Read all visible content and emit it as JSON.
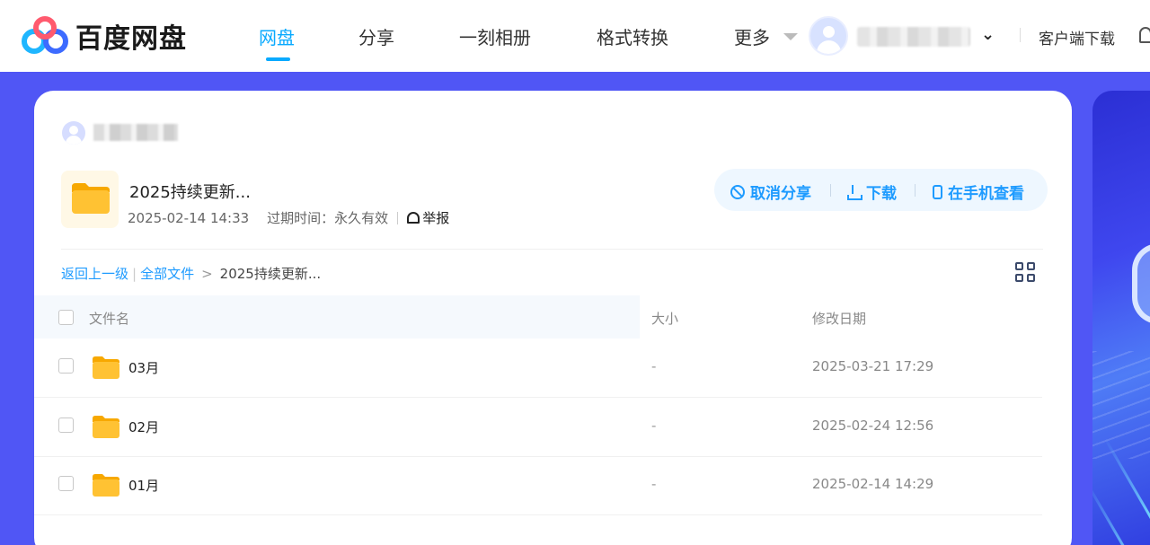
{
  "brand": {
    "name": "百度网盘"
  },
  "nav": {
    "items": [
      {
        "label": "网盘",
        "active": true
      },
      {
        "label": "分享",
        "active": false
      },
      {
        "label": "一刻相册",
        "active": false
      },
      {
        "label": "格式转换",
        "active": false
      },
      {
        "label": "更多",
        "active": false
      }
    ],
    "client_download": "客户端下载"
  },
  "share": {
    "title": "2025持续更新...",
    "date": "2025-02-14 14:33",
    "expire_label": "过期时间：永久有效",
    "report": "举报"
  },
  "actions": {
    "cancel_share": "取消分享",
    "download": "下载",
    "view_on_phone": "在手机查看"
  },
  "breadcrumb": {
    "back": "返回上一级",
    "all_files": "全部文件",
    "current": "2025持续更新..."
  },
  "table": {
    "columns": {
      "name": "文件名",
      "size": "大小",
      "modified": "修改日期"
    },
    "rows": [
      {
        "name": "03月",
        "size": "-",
        "modified": "2025-03-21 17:29"
      },
      {
        "name": "02月",
        "size": "-",
        "modified": "2025-02-24 12:56"
      },
      {
        "name": "01月",
        "size": "-",
        "modified": "2025-02-14 14:29"
      }
    ]
  },
  "colors": {
    "accent": "#09aaff",
    "background": "#5056f5",
    "folder": "#ffc233"
  }
}
